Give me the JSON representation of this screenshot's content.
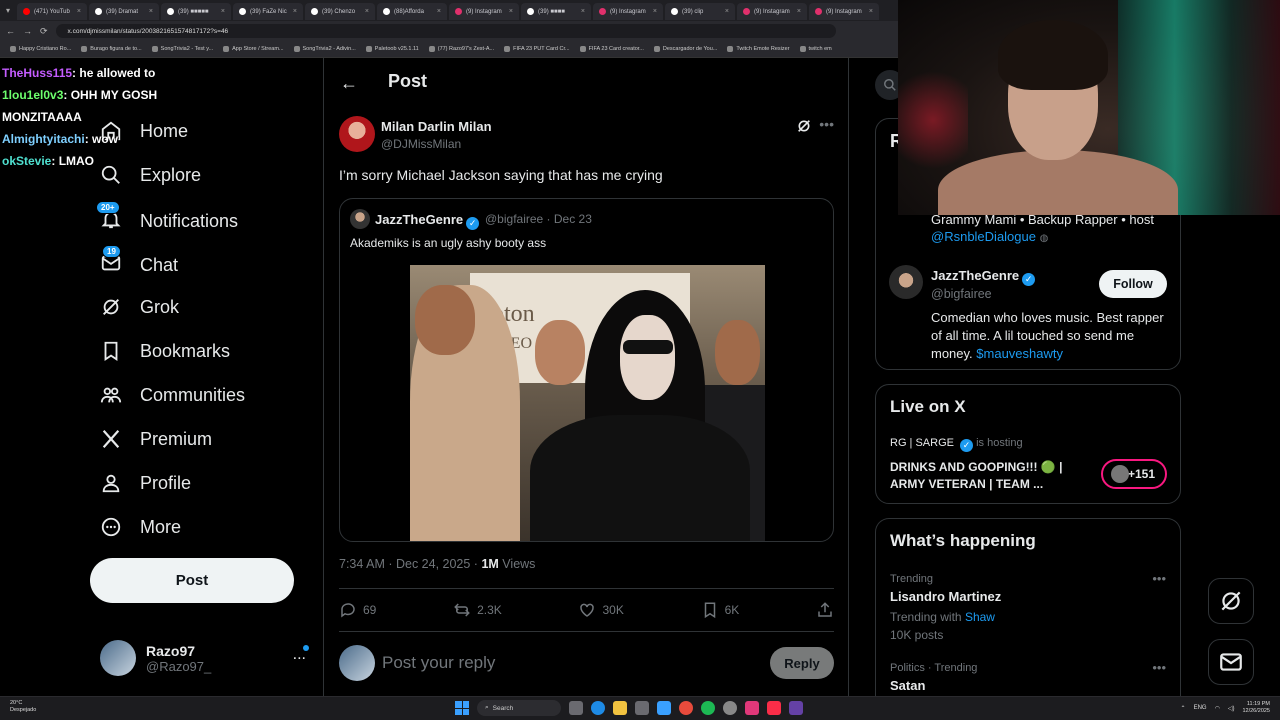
{
  "browser": {
    "tabs": [
      {
        "label": "(471) YouTub",
        "color": "#ff0000"
      },
      {
        "label": "(39) Dramat",
        "color": "#ffffff"
      },
      {
        "label": "(39) ■■■■■",
        "color": "#ffffff"
      },
      {
        "label": "(39) FaZe Nic",
        "color": "#ffffff"
      },
      {
        "label": "(39) Chenzo",
        "color": "#ffffff"
      },
      {
        "label": "(88)Afforda",
        "color": "#ffffff"
      },
      {
        "label": "(9) Instagram",
        "color": "#e1306c"
      },
      {
        "label": "(39) ■■■■",
        "color": "#ffffff"
      },
      {
        "label": "(9) Instagram",
        "color": "#e1306c"
      },
      {
        "label": "(39) clip",
        "color": "#ffffff"
      },
      {
        "label": "(9) Instagram",
        "color": "#e1306c"
      },
      {
        "label": "(9) Instagram",
        "color": "#e1306c"
      }
    ],
    "url": "x.com/djmissmilan/status/2003821651574817172?s=46",
    "bookmarks": [
      "Happy Cristiano Ro...",
      "Burago figura de to...",
      "SongTrivia2 - Test y...",
      "App Store / Stream...",
      "SongTrivia2 - Adivin...",
      "Paletoob v25.1.11",
      "(77) Razo97's Zest-A...",
      "FIFA 23 PUT Card Cr...",
      "FIFA 23 Card creator...",
      "Descargador de You...",
      "Twitch Emote Resizer",
      "twitch em"
    ]
  },
  "chat": [
    {
      "user": "TheHuss115",
      "msg": ": he allowed to"
    },
    {
      "user": "1lou1el0v3",
      "msg": ": OHH MY GOSH"
    },
    {
      "user": "",
      "msg": "MONZITAAAA"
    },
    {
      "user": "Almightyitachi",
      "msg": ": wow"
    },
    {
      "user": "okStevie",
      "msg": ": LMAO"
    }
  ],
  "nav": {
    "home": "Home",
    "explore": "Explore",
    "notifications": "Notifications",
    "notifications_badge": "20+",
    "chat": "Chat",
    "chat_badge": "19",
    "grok": "Grok",
    "bookmarks": "Bookmarks",
    "communities": "Communities",
    "premium": "Premium",
    "profile": "Profile",
    "more": "More",
    "post_button": "Post"
  },
  "account": {
    "name": "Razo97",
    "handle": "@Razo97_",
    "more": "..."
  },
  "main": {
    "title": "Post",
    "author_name": "Milan Darlin Milan",
    "author_handle": "@DJMissMilan",
    "text": "I’m sorry Michael Jackson saying that has me crying",
    "quote": {
      "name": "JazzTheGenre",
      "handle_date": "@bigfairee · Dec 23",
      "text": "Akademiks is an ugly ashy booty ass",
      "media_sign": "pton",
      "media_sign_sub": "CEO"
    },
    "meta_time": "7:34 AM · Dec 24, 2025 · ",
    "meta_views": "1M",
    "meta_views_label": " Views",
    "actions": {
      "replies": "69",
      "reposts": "2.3K",
      "likes": "30K",
      "bookmarks": "6K"
    },
    "reply_placeholder": "Post your reply",
    "reply_button": "Reply"
  },
  "right": {
    "card_header_letter": "R",
    "bio1_text": "Grammy Mami • Backup Rapper • host",
    "bio1_link": "@RsnbleDialogue",
    "who_name": "JazzTheGenre",
    "who_handle": "@bigfairee",
    "follow": "Follow",
    "who_bio": "Comedian who loves music. Best rapper of all time. A lil touched so send me money. ",
    "who_bio_link": "$mauveshawty",
    "live_title": "Live on X",
    "live_host": "RG | SARGE",
    "live_hosting": "is hosting",
    "live_stream": "DRINKS AND GOOPING!!! 🟢 | ARMY VETERAN | TEAM ...",
    "live_count": "+151",
    "whats_happening": "What’s happening",
    "trends": [
      {
        "label": "Trending",
        "name": "Lisandro Martinez",
        "sub": "Trending with ",
        "sub_link": "Shaw",
        "posts": "10K posts"
      },
      {
        "label": "Politics · Trending",
        "name": "Satan"
      }
    ]
  },
  "taskbar": {
    "weather_temp": "20°C",
    "weather_desc": "Despejado",
    "search": "Search",
    "lang": "ENG",
    "time": "11:19 PM",
    "date": "12/26/2025"
  },
  "colors": {
    "accent": "#1d9bf0",
    "live": "#f91880",
    "bg": "#000000"
  }
}
